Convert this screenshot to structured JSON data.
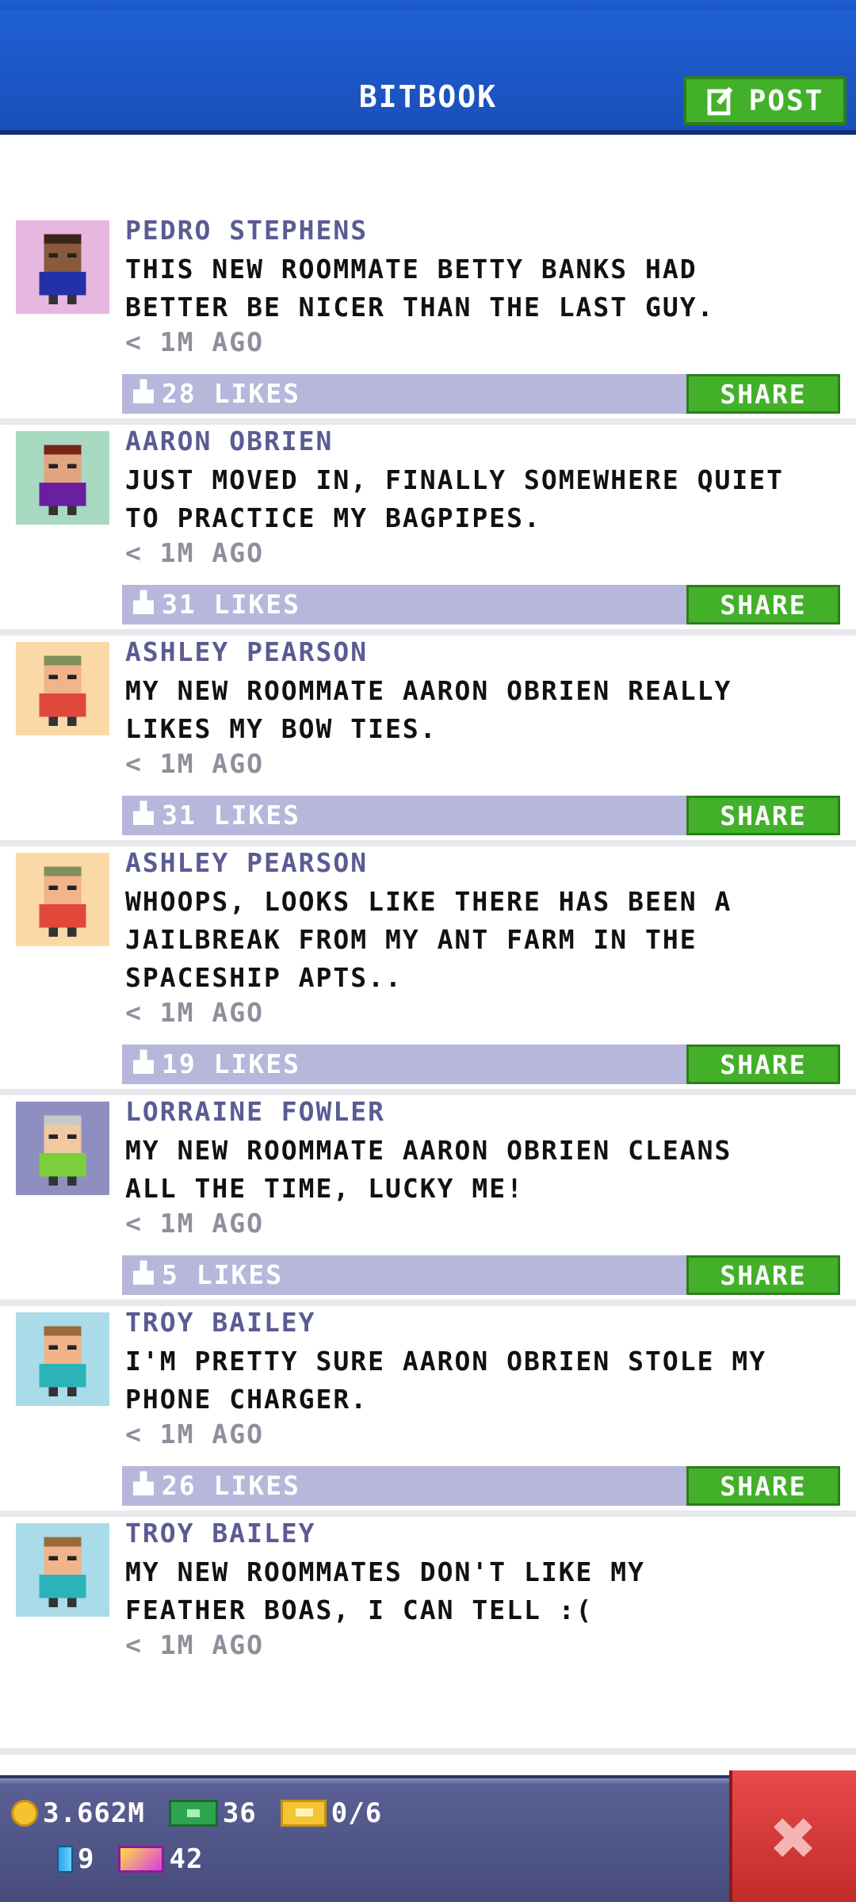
{
  "header": {
    "title": "BITBOOK",
    "post_label": "POST"
  },
  "posts": [
    {
      "author": "PEDRO STEPHENS",
      "lines": [
        "THIS NEW ROOMMATE BETTY BANKS HAD",
        "BETTER BE NICER THAN THE LAST GUY."
      ],
      "time": "< 1M AGO",
      "likes": "28 LIKES",
      "share": "SHARE",
      "avatar_bg": "#e8b7e0",
      "skin": "#8a5a3c",
      "shirt": "#2331a8",
      "hair": "#3a2616"
    },
    {
      "author": "AARON OBRIEN",
      "lines": [
        "JUST MOVED IN, FINALLY SOMEWHERE QUIET",
        "TO PRACTICE MY BAGPIPES."
      ],
      "time": "< 1M AGO",
      "likes": "31 LIKES",
      "share": "SHARE",
      "avatar_bg": "#a7d8c0",
      "skin": "#e0a57f",
      "shirt": "#6a1fa0",
      "hair": "#7a2418"
    },
    {
      "author": "ASHLEY PEARSON",
      "lines": [
        "MY NEW ROOMMATE AARON OBRIEN REALLY",
        "LIKES MY BOW TIES."
      ],
      "time": "< 1M AGO",
      "likes": "31 LIKES",
      "share": "SHARE",
      "avatar_bg": "#fbd9a7",
      "skin": "#f0b38a",
      "shirt": "#e2483a",
      "hair": "#7f8f5a"
    },
    {
      "author": "ASHLEY PEARSON",
      "lines": [
        "WHOOPS, LOOKS LIKE THERE HAS BEEN A",
        "JAILBREAK FROM MY ANT FARM IN THE",
        "SPACESHIP APTS.."
      ],
      "time": "< 1M AGO",
      "likes": "19 LIKES",
      "share": "SHARE",
      "avatar_bg": "#fbd9a7",
      "skin": "#f0b38a",
      "shirt": "#e2483a",
      "hair": "#7f8f5a"
    },
    {
      "author": "LORRAINE FOWLER",
      "lines": [
        "MY NEW ROOMMATE AARON OBRIEN CLEANS",
        "ALL THE TIME, LUCKY ME!"
      ],
      "time": "< 1M AGO",
      "likes": "5 LIKES",
      "share": "SHARE",
      "avatar_bg": "#8e8fc0",
      "skin": "#f0c9a2",
      "shirt": "#7ccf3a",
      "hair": "#c8c8c8"
    },
    {
      "author": "TROY BAILEY",
      "lines": [
        "I'M PRETTY SURE AARON OBRIEN STOLE MY",
        "PHONE CHARGER."
      ],
      "time": "< 1M AGO",
      "likes": "26 LIKES",
      "share": "SHARE",
      "avatar_bg": "#a9dbe8",
      "skin": "#f0b38a",
      "shirt": "#2cb3b8",
      "hair": "#9a6a3a"
    },
    {
      "author": "TROY BAILEY",
      "lines": [
        "MY NEW ROOMMATES DON'T LIKE MY",
        "FEATHER BOAS, I CAN TELL :("
      ],
      "time": "< 1M AGO",
      "likes": "",
      "share": "",
      "avatar_bg": "#a9dbe8",
      "skin": "#f0b38a",
      "shirt": "#2cb3b8",
      "hair": "#9a6a3a"
    }
  ],
  "status": {
    "coins": "3.662M",
    "bux": "36",
    "tickets": "0/6",
    "bars": "9",
    "vip": "42"
  },
  "colors": {
    "header": "#1f5fd6",
    "accent_green": "#43b02a",
    "like_bar": "#b6b7da",
    "author": "#5b5b94",
    "close_red": "#d83636"
  }
}
